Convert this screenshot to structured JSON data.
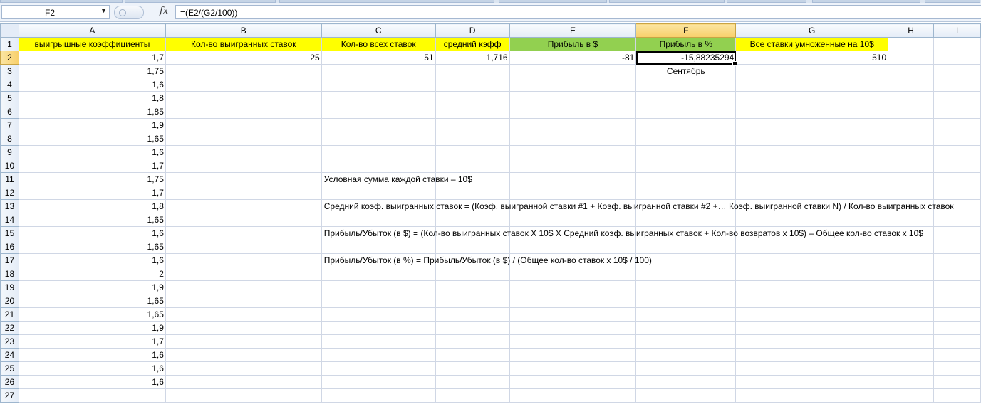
{
  "formula_bar": {
    "name_box": "F2",
    "fx_label": "fx",
    "formula": "=(E2/(G2/100))"
  },
  "columns": [
    "A",
    "B",
    "C",
    "D",
    "E",
    "F",
    "G",
    "H",
    "I"
  ],
  "rows": {
    "1": {
      "A": "выигрышные коэффициенты",
      "B": "Кол-во выигранных ставок",
      "C": "Кол-во всех ставок",
      "D": "средний кэфф",
      "E": "Прибыль в $",
      "F": "Прибыль в %",
      "G": "Все ставки умноженные на 10$"
    },
    "2": {
      "A": "1,7",
      "B": "25",
      "C": "51",
      "D": "1,716",
      "E": "-81",
      "F": "-15,88235294",
      "G": "510"
    },
    "3": {
      "A": "1,75",
      "F": "Сентябрь"
    },
    "4": {
      "A": "1,6"
    },
    "5": {
      "A": "1,8"
    },
    "6": {
      "A": "1,85"
    },
    "7": {
      "A": "1,9"
    },
    "8": {
      "A": "1,65"
    },
    "9": {
      "A": "1,6"
    },
    "10": {
      "A": "1,7"
    },
    "11": {
      "A": "1,75",
      "C": "Условная сумма каждой ставки – 10$"
    },
    "12": {
      "A": "1,7"
    },
    "13": {
      "A": "1,8",
      "C": "Средний коэф. выигранных ставок = (Коэф. выигранной ставки #1 + Коэф. выигранной ставки #2 +… Коэф. выигранной ставки N) / Кол-во выигранных ставок"
    },
    "14": {
      "A": "1,65"
    },
    "15": {
      "A": "1,6",
      "C": "Прибыль/Убыток (в $) = (Кол-во выигранных ставок X 10$ X Средний коэф. выигранных ставок + Кол-во возвратов х 10$) – Общее кол-во ставок х 10$"
    },
    "16": {
      "A": "1,65"
    },
    "17": {
      "A": "1,6",
      "C": "Прибыль/Убыток (в %) = Прибыль/Убыток (в $) / (Общее кол-во ставок х 10$ / 100)"
    },
    "18": {
      "A": "2"
    },
    "19": {
      "A": "1,9"
    },
    "20": {
      "A": "1,65"
    },
    "21": {
      "A": "1,65"
    },
    "22": {
      "A": "1,9"
    },
    "23": {
      "A": "1,7"
    },
    "24": {
      "A": "1,6"
    },
    "25": {
      "A": "1,6"
    },
    "26": {
      "A": "1,6"
    },
    "27": {}
  },
  "row_labels": [
    "1",
    "2",
    "3",
    "4",
    "5",
    "6",
    "7",
    "8",
    "9",
    "10",
    "11",
    "12",
    "13",
    "14",
    "15",
    "16",
    "17",
    "18",
    "19",
    "20",
    "21",
    "22",
    "23",
    "24",
    "25",
    "26",
    "27"
  ],
  "selected": {
    "column": "F",
    "row": "2"
  }
}
